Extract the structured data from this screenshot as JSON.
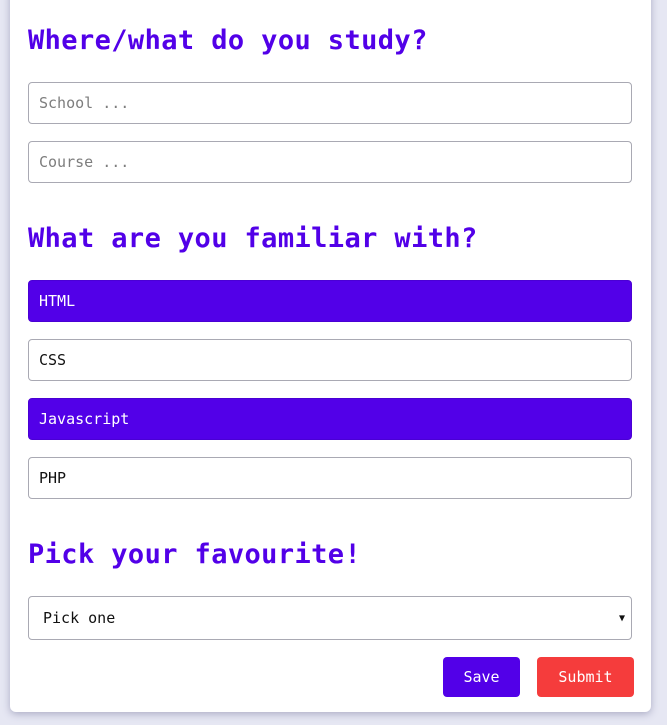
{
  "study": {
    "heading": "Where/what do you study?",
    "school_placeholder": "School ...",
    "course_placeholder": "Course ..."
  },
  "familiar": {
    "heading": "What are you familiar with?",
    "options": [
      {
        "label": "HTML",
        "selected": true
      },
      {
        "label": "CSS",
        "selected": false
      },
      {
        "label": "Javascript",
        "selected": true
      },
      {
        "label": "PHP",
        "selected": false
      }
    ]
  },
  "favourite": {
    "heading": "Pick your favourite!",
    "selected_value": "Pick one",
    "caret_icon": "triangle-down-icon"
  },
  "actions": {
    "save_label": "Save",
    "submit_label": "Submit"
  },
  "colors": {
    "accent": "#5200e8",
    "danger": "#f53c3c"
  }
}
